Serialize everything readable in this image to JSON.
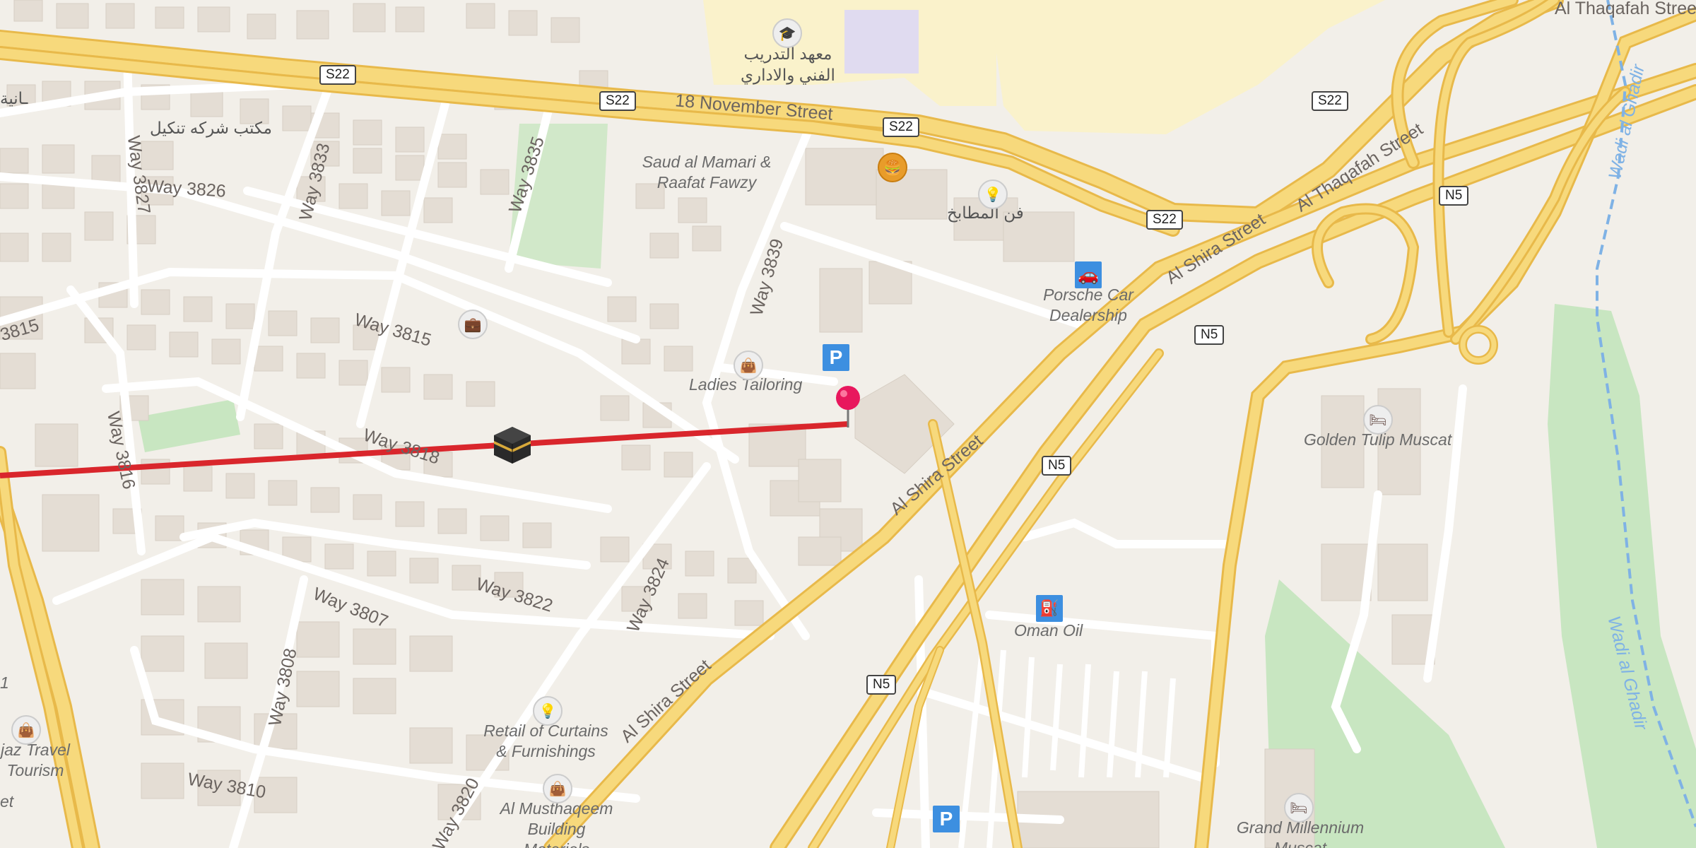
{
  "map": {
    "route_color": "#d9262c",
    "road_color": "#f7d97c",
    "road_casing": "#e8b94a",
    "park_color": "#c8e6c1",
    "institution_color": "#faf2cb",
    "building_color": "#e4ddd4",
    "water_color": "#7fb2e5"
  },
  "shields": [
    {
      "text": "S22"
    },
    {
      "text": "S22"
    },
    {
      "text": "S22"
    },
    {
      "text": "S22"
    },
    {
      "text": "S22"
    },
    {
      "text": "N5"
    },
    {
      "text": "N5"
    },
    {
      "text": "N5"
    },
    {
      "text": "N5"
    }
  ],
  "streets": {
    "nov18": "18 November Street",
    "thaqafah": "Al Thaqafah Street",
    "thaqafah_top": "Al Thaqafah Street",
    "shira1": "Al Shira Street",
    "shira2": "Al Shira Street",
    "shira3": "Al Shira Street",
    "way3826": "Way 3826",
    "way3827": "Way 3827",
    "way3833": "Way 3833",
    "way3835": "Way 3835",
    "way3815": "Way 3815",
    "way3815b": "3815",
    "way3839": "Way 3839",
    "way3818": "Way 3818",
    "way3816": "Way 3816",
    "way3822": "Way 3822",
    "way3807": "Way 3807",
    "way3824": "Way 3824",
    "way3808": "Way 3808",
    "way3810": "Way 3810",
    "way3820": "Way 3820",
    "wadi1": "Wadi al Ghadir",
    "wadi2": "Wadi al Ghadir"
  },
  "pois": {
    "institute": "معهد التدريب الفني والاداري",
    "office_arabic": "مكتب شركه تنكيل",
    "left_arabic": "ـانية",
    "saud": "Saud al Mamari & Raafat Fawzy",
    "kitchen": "فن المطابخ",
    "porsche": "Porsche Car Dealership",
    "ladies": "Ladies Tailoring",
    "golden": "Golden Tulip Muscat",
    "oman_oil": "Oman Oil",
    "curtains": "Retail of Curtains & Furnishings",
    "musthaqeem": "Al Musthaqeem Building Materials",
    "hijaz": "jaz Travel Tourism",
    "millennium": "Grand Millennium Muscat",
    "left_edge1": "et",
    "left_edge2": "1"
  },
  "icons": {
    "institute": "graduation-cap-icon",
    "burger": "fast-food-icon",
    "lamp": "furniture-lamp-icon",
    "car": "car-dealer-icon",
    "suitcase": "travel-agency-icon",
    "bag": "shop-bag-icon",
    "parking": "P",
    "hotel": "hotel-bed-icon",
    "fuel": "fuel-station-icon"
  }
}
